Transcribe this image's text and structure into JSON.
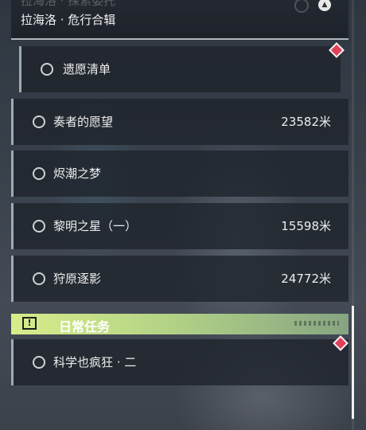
{
  "header": {
    "faded_text": "拉海洛 · 探索委托",
    "title": "拉海洛 · 危行合辑"
  },
  "quests": [
    {
      "label": "遗愿清单",
      "distance": "",
      "sub": true,
      "tracked": true
    },
    {
      "label": "奏者的愿望",
      "distance": "23582米"
    },
    {
      "label": "烬潮之梦",
      "distance": ""
    },
    {
      "label": "黎明之星（一）",
      "distance": "15598米"
    },
    {
      "label": "狩原逐影",
      "distance": "24772米"
    }
  ],
  "category": {
    "title": "日常任务",
    "badge": "!",
    "accent": "#d8ec8a"
  },
  "daily_quests": [
    {
      "label": "科学也疯狂 · 二",
      "distance": "",
      "tracked": true
    }
  ],
  "colors": {
    "tracked_marker": "#e0405a",
    "panel": "#1e222a"
  },
  "icons": {
    "quest_status": "circle-icon",
    "tracked": "diamond-marker-icon",
    "category": "exclamation-icon",
    "collapse": "chevron-up-icon"
  }
}
